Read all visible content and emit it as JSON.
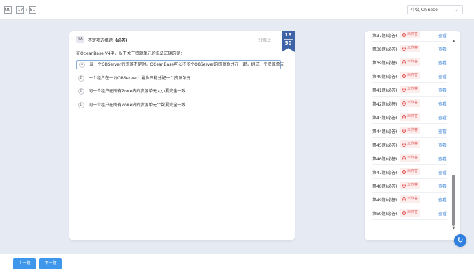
{
  "timer": {
    "hours": "00",
    "minutes": "17",
    "seconds": "51"
  },
  "language": {
    "selected": "中文 Chinese"
  },
  "question": {
    "number": "18",
    "type": "不定项选择题",
    "required": "(必答)",
    "score": "分值:2",
    "current": "18",
    "total": "50",
    "text": "在OceanBase V4中，以下关于资源单元的说法正确的是：",
    "options": [
      {
        "letter": "A",
        "text": "当一个OBServer的资源不足时，OCeanBase可以将多个OBServer的资源合并在一起，组成一个资源单元",
        "selected": true
      },
      {
        "letter": "B",
        "text": "一个租户在一台OBServer上最多只能分配一个资源单元",
        "selected": false
      },
      {
        "letter": "C",
        "text": "同一个租户在所有Zone内的资源单元大小要完全一致",
        "selected": false
      },
      {
        "letter": "D",
        "text": "同一个租户在所有Zone内的资源单元个数要完全一致",
        "selected": false
      }
    ]
  },
  "answer_sheet": {
    "rows": [
      {
        "label": "第37题(必答)",
        "status": "未作答",
        "action": "查看"
      },
      {
        "label": "第38题(必答)",
        "status": "未作答",
        "action": "查看"
      },
      {
        "label": "第39题(必答)",
        "status": "未作答",
        "action": "查看"
      },
      {
        "label": "第40题(必答)",
        "status": "未作答",
        "action": "查看"
      },
      {
        "label": "第41题(必答)",
        "status": "未作答",
        "action": "查看"
      },
      {
        "label": "第42题(必答)",
        "status": "未作答",
        "action": "查看"
      },
      {
        "label": "第43题(必答)",
        "status": "未作答",
        "action": "查看"
      },
      {
        "label": "第44题(必答)",
        "status": "未作答",
        "action": "查看"
      },
      {
        "label": "第45题(必答)",
        "status": "未作答",
        "action": "查看"
      },
      {
        "label": "第46题(必答)",
        "status": "未作答",
        "action": "查看"
      },
      {
        "label": "第47题(必答)",
        "status": "未作答",
        "action": "查看"
      },
      {
        "label": "第48题(必答)",
        "status": "未作答",
        "action": "查看"
      },
      {
        "label": "第49题(必答)",
        "status": "未作答",
        "action": "查看"
      },
      {
        "label": "第50题(必答)",
        "status": "未作答",
        "action": "查看"
      }
    ]
  },
  "nav": {
    "prev_label": "上一题",
    "next_label": "下一题"
  },
  "colors": {
    "accent": "#3f97ec",
    "ribbon": "#3e64a7",
    "status_unanswered": "#e05b5b",
    "link": "#3b82d6"
  },
  "icons": {
    "status": "close-circle-icon",
    "refresh": "refresh-icon",
    "select": "chevron-down-icon"
  }
}
